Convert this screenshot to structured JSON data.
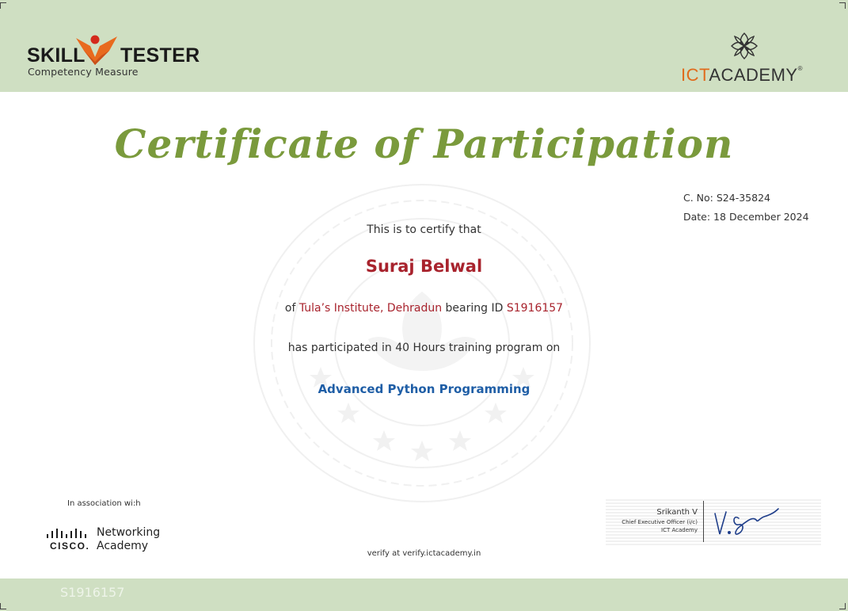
{
  "colors": {
    "band": "#cfdfc2",
    "title": "#7a9a3c",
    "name": "#a8232d",
    "course": "#1f5ea6",
    "skill_logo_orange": "#e86a1e",
    "skill_logo_red": "#d42a1c",
    "ict_orange": "#e06b1c"
  },
  "header": {
    "skill_logo": {
      "word_left": "SKILL",
      "word_right": "TESTER",
      "tagline": "Competency  Measure",
      "icon": "skill-tester-mark-icon"
    },
    "ict_logo": {
      "part_1": "ICT",
      "part_2": "ACADEMY",
      "registered": "®",
      "icon": "ict-academy-flower-icon"
    }
  },
  "certificate": {
    "title": "Certificate of Participation",
    "number": "C. No: S24-35824",
    "date": "Date: 18 December 2024",
    "intro": "This is to certify that",
    "name": "Suraj Belwal",
    "of_label": "of",
    "institution": "Tula’s Institute, Dehradun",
    "bearing_label": "bearing ID",
    "id": "S1916157",
    "hours_text": "has participated in 40 Hours training program on",
    "course": "Advanced Python Programming",
    "seal_icon": "seal-watermark-icon"
  },
  "footer": {
    "association_label": "In association wi:h",
    "cisco": {
      "word": "CISCO.",
      "academy_line_1": "Networking",
      "academy_line_2": "Academy",
      "icon": "cisco-bridge-icon"
    },
    "verify_text": "verify at verify.ictacademy.in",
    "signatory": {
      "name": "Srikanth V",
      "role_line_1": "Chief Executive Officer (i/c)",
      "role_line_2": "ICT Academy",
      "signature_icon": "signature-icon"
    },
    "bottom_id": "S1916157"
  }
}
